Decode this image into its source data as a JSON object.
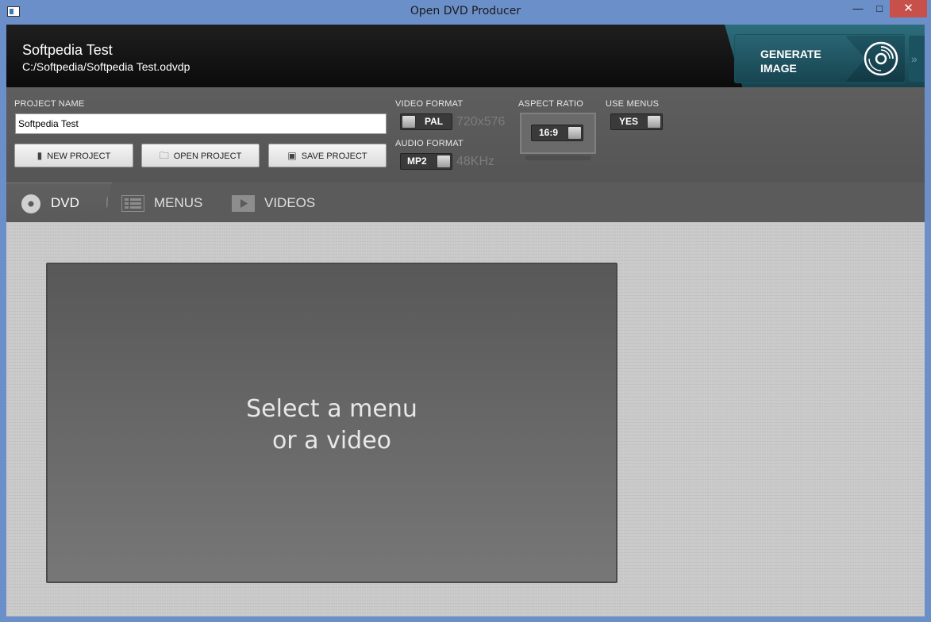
{
  "window": {
    "title": "Open DVD Producer"
  },
  "project": {
    "name": "Softpedia Test",
    "path": "C:/Softpedia/Softpedia Test.odvdp"
  },
  "generate": {
    "label_line1": "GENERATE",
    "label_line2": "IMAGE"
  },
  "form": {
    "project_name_label": "PROJECT NAME",
    "project_name_value": "Softpedia Test",
    "new_label": "NEW PROJECT",
    "open_label": "OPEN PROJECT",
    "save_label": "SAVE PROJECT"
  },
  "video_format": {
    "label": "VIDEO FORMAT",
    "value": "PAL",
    "resolution": "720x576"
  },
  "audio_format": {
    "label": "AUDIO FORMAT",
    "value": "MP2",
    "rate": "48KHz"
  },
  "aspect_ratio": {
    "label": "ASPECT RATIO",
    "value": "16:9"
  },
  "use_menus": {
    "label": "USE MENUS",
    "value": "YES"
  },
  "tabs": [
    {
      "label": "DVD",
      "icon": "disc-icon",
      "active": true
    },
    {
      "label": "MENUS",
      "icon": "menu-list-icon",
      "active": false
    },
    {
      "label": "VIDEOS",
      "icon": "play-icon",
      "active": false
    }
  ],
  "preview": {
    "message_line1": "Select a menu",
    "message_line2": "or a video"
  },
  "colors": {
    "accent": "#2a6573",
    "chrome": "#6b8fc9",
    "panel": "#5b5b5b",
    "close": "#c7504b"
  }
}
